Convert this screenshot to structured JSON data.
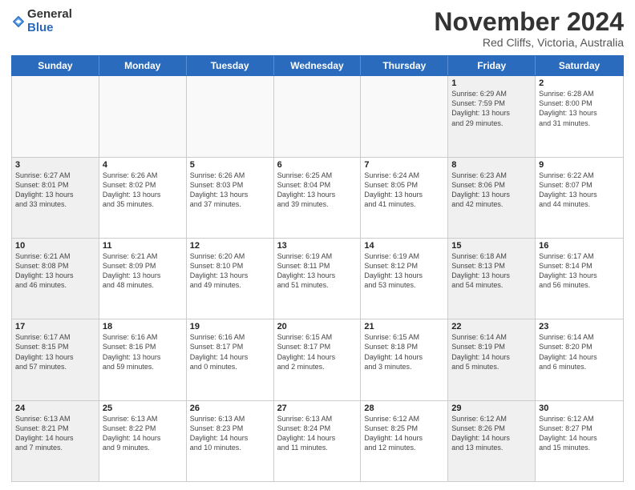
{
  "header": {
    "logo_general": "General",
    "logo_blue": "Blue",
    "title": "November 2024",
    "location": "Red Cliffs, Victoria, Australia"
  },
  "days_of_week": [
    "Sunday",
    "Monday",
    "Tuesday",
    "Wednesday",
    "Thursday",
    "Friday",
    "Saturday"
  ],
  "rows": [
    [
      {
        "day": "",
        "info": "",
        "empty": true
      },
      {
        "day": "",
        "info": "",
        "empty": true
      },
      {
        "day": "",
        "info": "",
        "empty": true
      },
      {
        "day": "",
        "info": "",
        "empty": true
      },
      {
        "day": "",
        "info": "",
        "empty": true
      },
      {
        "day": "1",
        "info": "Sunrise: 6:29 AM\nSunset: 7:59 PM\nDaylight: 13 hours\nand 29 minutes.",
        "shaded": true
      },
      {
        "day": "2",
        "info": "Sunrise: 6:28 AM\nSunset: 8:00 PM\nDaylight: 13 hours\nand 31 minutes.",
        "shaded": false
      }
    ],
    [
      {
        "day": "3",
        "info": "Sunrise: 6:27 AM\nSunset: 8:01 PM\nDaylight: 13 hours\nand 33 minutes.",
        "shaded": true
      },
      {
        "day": "4",
        "info": "Sunrise: 6:26 AM\nSunset: 8:02 PM\nDaylight: 13 hours\nand 35 minutes.",
        "shaded": false
      },
      {
        "day": "5",
        "info": "Sunrise: 6:26 AM\nSunset: 8:03 PM\nDaylight: 13 hours\nand 37 minutes.",
        "shaded": false
      },
      {
        "day": "6",
        "info": "Sunrise: 6:25 AM\nSunset: 8:04 PM\nDaylight: 13 hours\nand 39 minutes.",
        "shaded": false
      },
      {
        "day": "7",
        "info": "Sunrise: 6:24 AM\nSunset: 8:05 PM\nDaylight: 13 hours\nand 41 minutes.",
        "shaded": false
      },
      {
        "day": "8",
        "info": "Sunrise: 6:23 AM\nSunset: 8:06 PM\nDaylight: 13 hours\nand 42 minutes.",
        "shaded": true
      },
      {
        "day": "9",
        "info": "Sunrise: 6:22 AM\nSunset: 8:07 PM\nDaylight: 13 hours\nand 44 minutes.",
        "shaded": false
      }
    ],
    [
      {
        "day": "10",
        "info": "Sunrise: 6:21 AM\nSunset: 8:08 PM\nDaylight: 13 hours\nand 46 minutes.",
        "shaded": true
      },
      {
        "day": "11",
        "info": "Sunrise: 6:21 AM\nSunset: 8:09 PM\nDaylight: 13 hours\nand 48 minutes.",
        "shaded": false
      },
      {
        "day": "12",
        "info": "Sunrise: 6:20 AM\nSunset: 8:10 PM\nDaylight: 13 hours\nand 49 minutes.",
        "shaded": false
      },
      {
        "day": "13",
        "info": "Sunrise: 6:19 AM\nSunset: 8:11 PM\nDaylight: 13 hours\nand 51 minutes.",
        "shaded": false
      },
      {
        "day": "14",
        "info": "Sunrise: 6:19 AM\nSunset: 8:12 PM\nDaylight: 13 hours\nand 53 minutes.",
        "shaded": false
      },
      {
        "day": "15",
        "info": "Sunrise: 6:18 AM\nSunset: 8:13 PM\nDaylight: 13 hours\nand 54 minutes.",
        "shaded": true
      },
      {
        "day": "16",
        "info": "Sunrise: 6:17 AM\nSunset: 8:14 PM\nDaylight: 13 hours\nand 56 minutes.",
        "shaded": false
      }
    ],
    [
      {
        "day": "17",
        "info": "Sunrise: 6:17 AM\nSunset: 8:15 PM\nDaylight: 13 hours\nand 57 minutes.",
        "shaded": true
      },
      {
        "day": "18",
        "info": "Sunrise: 6:16 AM\nSunset: 8:16 PM\nDaylight: 13 hours\nand 59 minutes.",
        "shaded": false
      },
      {
        "day": "19",
        "info": "Sunrise: 6:16 AM\nSunset: 8:17 PM\nDaylight: 14 hours\nand 0 minutes.",
        "shaded": false
      },
      {
        "day": "20",
        "info": "Sunrise: 6:15 AM\nSunset: 8:17 PM\nDaylight: 14 hours\nand 2 minutes.",
        "shaded": false
      },
      {
        "day": "21",
        "info": "Sunrise: 6:15 AM\nSunset: 8:18 PM\nDaylight: 14 hours\nand 3 minutes.",
        "shaded": false
      },
      {
        "day": "22",
        "info": "Sunrise: 6:14 AM\nSunset: 8:19 PM\nDaylight: 14 hours\nand 5 minutes.",
        "shaded": true
      },
      {
        "day": "23",
        "info": "Sunrise: 6:14 AM\nSunset: 8:20 PM\nDaylight: 14 hours\nand 6 minutes.",
        "shaded": false
      }
    ],
    [
      {
        "day": "24",
        "info": "Sunrise: 6:13 AM\nSunset: 8:21 PM\nDaylight: 14 hours\nand 7 minutes.",
        "shaded": true
      },
      {
        "day": "25",
        "info": "Sunrise: 6:13 AM\nSunset: 8:22 PM\nDaylight: 14 hours\nand 9 minutes.",
        "shaded": false
      },
      {
        "day": "26",
        "info": "Sunrise: 6:13 AM\nSunset: 8:23 PM\nDaylight: 14 hours\nand 10 minutes.",
        "shaded": false
      },
      {
        "day": "27",
        "info": "Sunrise: 6:13 AM\nSunset: 8:24 PM\nDaylight: 14 hours\nand 11 minutes.",
        "shaded": false
      },
      {
        "day": "28",
        "info": "Sunrise: 6:12 AM\nSunset: 8:25 PM\nDaylight: 14 hours\nand 12 minutes.",
        "shaded": false
      },
      {
        "day": "29",
        "info": "Sunrise: 6:12 AM\nSunset: 8:26 PM\nDaylight: 14 hours\nand 13 minutes.",
        "shaded": true
      },
      {
        "day": "30",
        "info": "Sunrise: 6:12 AM\nSunset: 8:27 PM\nDaylight: 14 hours\nand 15 minutes.",
        "shaded": false
      }
    ]
  ]
}
